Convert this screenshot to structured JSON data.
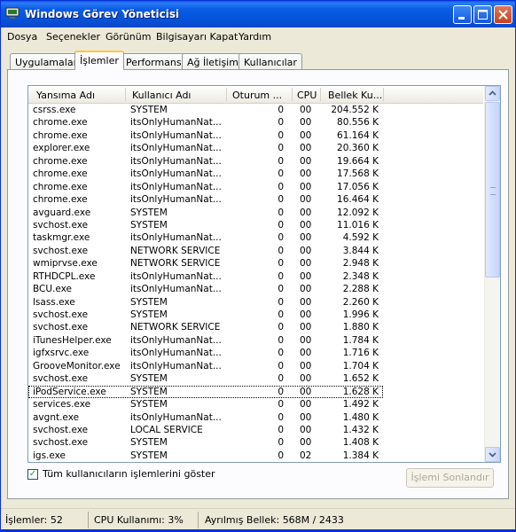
{
  "window": {
    "title": "Windows Görev Yöneticisi"
  },
  "menu": [
    "Dosya",
    "Seçenekler",
    "Görünüm",
    "Bilgisayarı Kapat",
    "Yardım"
  ],
  "tabs": [
    "Uygulamalar",
    "İşlemler",
    "Performans",
    "Ağ İletişimi",
    "Kullanıcılar"
  ],
  "active_tab": "İşlemler",
  "columns": [
    "Yansıma Adı",
    "Kullanıcı Adı",
    "Oturum ...",
    "CPU",
    "Bellek Ku..."
  ],
  "processes": [
    {
      "name": "csrss.exe",
      "user": "SYSTEM",
      "session": "0",
      "cpu": "00",
      "mem": "204.552 K"
    },
    {
      "name": "chrome.exe",
      "user": "itsOnlyHumanNat...",
      "session": "0",
      "cpu": "00",
      "mem": "80.556 K"
    },
    {
      "name": "chrome.exe",
      "user": "itsOnlyHumanNat...",
      "session": "0",
      "cpu": "00",
      "mem": "61.164 K"
    },
    {
      "name": "explorer.exe",
      "user": "itsOnlyHumanNat...",
      "session": "0",
      "cpu": "00",
      "mem": "20.360 K"
    },
    {
      "name": "chrome.exe",
      "user": "itsOnlyHumanNat...",
      "session": "0",
      "cpu": "00",
      "mem": "19.664 K"
    },
    {
      "name": "chrome.exe",
      "user": "itsOnlyHumanNat...",
      "session": "0",
      "cpu": "00",
      "mem": "17.568 K"
    },
    {
      "name": "chrome.exe",
      "user": "itsOnlyHumanNat...",
      "session": "0",
      "cpu": "00",
      "mem": "17.056 K"
    },
    {
      "name": "chrome.exe",
      "user": "itsOnlyHumanNat...",
      "session": "0",
      "cpu": "00",
      "mem": "16.464 K"
    },
    {
      "name": "avguard.exe",
      "user": "SYSTEM",
      "session": "0",
      "cpu": "00",
      "mem": "12.092 K"
    },
    {
      "name": "svchost.exe",
      "user": "SYSTEM",
      "session": "0",
      "cpu": "00",
      "mem": "11.016 K"
    },
    {
      "name": "taskmgr.exe",
      "user": "itsOnlyHumanNat...",
      "session": "0",
      "cpu": "00",
      "mem": "4.592 K"
    },
    {
      "name": "svchost.exe",
      "user": "NETWORK SERVICE",
      "session": "0",
      "cpu": "00",
      "mem": "3.844 K"
    },
    {
      "name": "wmiprvse.exe",
      "user": "NETWORK SERVICE",
      "session": "0",
      "cpu": "00",
      "mem": "2.948 K"
    },
    {
      "name": "RTHDCPL.exe",
      "user": "itsOnlyHumanNat...",
      "session": "0",
      "cpu": "00",
      "mem": "2.348 K"
    },
    {
      "name": "BCU.exe",
      "user": "itsOnlyHumanNat...",
      "session": "0",
      "cpu": "00",
      "mem": "2.288 K"
    },
    {
      "name": "lsass.exe",
      "user": "SYSTEM",
      "session": "0",
      "cpu": "00",
      "mem": "2.260 K"
    },
    {
      "name": "svchost.exe",
      "user": "SYSTEM",
      "session": "0",
      "cpu": "00",
      "mem": "1.996 K"
    },
    {
      "name": "svchost.exe",
      "user": "NETWORK SERVICE",
      "session": "0",
      "cpu": "00",
      "mem": "1.880 K"
    },
    {
      "name": "iTunesHelper.exe",
      "user": "itsOnlyHumanNat...",
      "session": "0",
      "cpu": "00",
      "mem": "1.784 K"
    },
    {
      "name": "igfxsrvc.exe",
      "user": "itsOnlyHumanNat...",
      "session": "0",
      "cpu": "00",
      "mem": "1.716 K"
    },
    {
      "name": "GrooveMonitor.exe",
      "user": "itsOnlyHumanNat...",
      "session": "0",
      "cpu": "00",
      "mem": "1.704 K"
    },
    {
      "name": "svchost.exe",
      "user": "SYSTEM",
      "session": "0",
      "cpu": "00",
      "mem": "1.652 K"
    },
    {
      "name": "iPodService.exe",
      "user": "SYSTEM",
      "session": "0",
      "cpu": "00",
      "mem": "1.628 K"
    },
    {
      "name": "services.exe",
      "user": "SYSTEM",
      "session": "0",
      "cpu": "00",
      "mem": "1.492 K"
    },
    {
      "name": "avgnt.exe",
      "user": "itsOnlyHumanNat...",
      "session": "0",
      "cpu": "00",
      "mem": "1.480 K"
    },
    {
      "name": "svchost.exe",
      "user": "LOCAL SERVICE",
      "session": "0",
      "cpu": "00",
      "mem": "1.432 K"
    },
    {
      "name": "svchost.exe",
      "user": "SYSTEM",
      "session": "0",
      "cpu": "00",
      "mem": "1.408 K"
    },
    {
      "name": "igs.exe",
      "user": "SYSTEM",
      "session": "0",
      "cpu": "02",
      "mem": "1.384 K"
    }
  ],
  "focused_row_index": 22,
  "show_all_users": {
    "label": "Tüm kullanıcıların işlemlerini göster",
    "checked": true
  },
  "end_process_button": "İşlemi Sonlandır",
  "status": {
    "processes": "İşlemler: 52",
    "cpu": "CPU Kullanımı: 3%",
    "commit": "Ayrılmış Bellek: 568M / 2433"
  },
  "colors": {
    "titlebar": "#0a5de6",
    "close_button": "#c7401f",
    "active_tab_accent": "#ffc83c",
    "check": "#21a121"
  },
  "icons": [
    "task-manager-icon",
    "minimize-icon",
    "maximize-icon",
    "close-icon",
    "scroll-up-icon",
    "scroll-down-icon"
  ]
}
